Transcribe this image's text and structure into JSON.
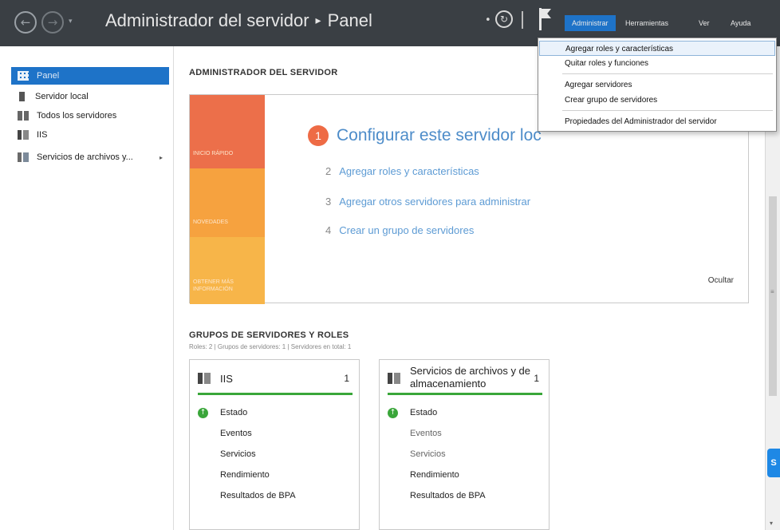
{
  "window": {
    "title_app": "Administrador del servidor",
    "title_sep": "▸",
    "title_page": "Panel",
    "nav_back": "←",
    "nav_forward": "→",
    "nav_dropdown": "▾",
    "refresh_dot": "•",
    "refresh_icon": "↻"
  },
  "menubar": {
    "administrar": "Administrar",
    "herramientas": "Herramientas",
    "ver": "Ver",
    "ayuda": "Ayuda"
  },
  "dropdown": {
    "items": [
      "Agregar roles y características",
      "Quitar roles y funciones",
      "Agregar servidores",
      "Crear grupo de servidores",
      "Propiedades del Administrador del servidor"
    ]
  },
  "sidebar": {
    "items": [
      {
        "label": "Panel",
        "icon": "dashboard-icon"
      },
      {
        "label": "Servidor local",
        "icon": "server-icon"
      },
      {
        "label": "Todos los servidores",
        "icon": "servers-icon"
      },
      {
        "label": "IIS",
        "icon": "iis-icon"
      },
      {
        "label": "Servicios de archivos y...",
        "icon": "file-services-icon"
      }
    ],
    "expand_arrow": "▸"
  },
  "main": {
    "heading": "ADMINISTRADOR DEL SERVIDOR",
    "tiles": [
      "INICIO RÁPIDO",
      "NOVEDADES",
      "OBTENER MÁS INFORMACIÓN"
    ],
    "step1_num": "1",
    "step1_text": "Configurar este servidor loc",
    "links": [
      {
        "num": "2",
        "text": "Agregar roles y características"
      },
      {
        "num": "3",
        "text": "Agregar otros servidores para administrar"
      },
      {
        "num": "4",
        "text": "Crear un grupo de servidores"
      }
    ],
    "hide": "Ocultar",
    "groups_heading": "GRUPOS DE SERVIDORES Y ROLES",
    "groups_sub": "Roles: 2  |  Grupos de servidores: 1  |  Servidores en total: 1",
    "status_glyph": "↑"
  },
  "cards": [
    {
      "title": "IIS",
      "count": "1",
      "rows": [
        "Estado",
        "Eventos",
        "Servicios",
        "Rendimiento",
        "Resultados de BPA"
      ]
    },
    {
      "title": "Servicios de archivos y de almacenamiento",
      "count": "1",
      "rows": [
        "Estado",
        "Eventos",
        "Servicios",
        "Rendimiento",
        "Resultados de BPA"
      ]
    }
  ],
  "scrollbar": {
    "grip": "≡",
    "widget": "S",
    "down": "▾"
  },
  "colors": {
    "titlebar": "#3a3f44",
    "accent": "#1e73c8",
    "tile_quickstart": "#ec6f4a",
    "tile_news": "#f6a23f",
    "tile_learn": "#f7b549",
    "status_ok": "#3aa63a"
  }
}
